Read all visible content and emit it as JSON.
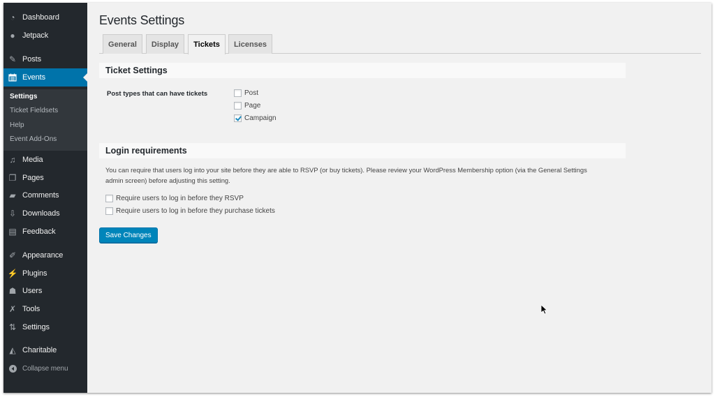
{
  "sidebar": {
    "items": [
      {
        "label": "Dashboard",
        "icon": "dashboard-icon"
      },
      {
        "label": "Jetpack",
        "icon": "jetpack-icon"
      },
      {
        "label": "Posts",
        "icon": "pin-icon"
      },
      {
        "label": "Events",
        "icon": "calendar-icon",
        "active": true
      },
      {
        "label": "Media",
        "icon": "media-icon"
      },
      {
        "label": "Pages",
        "icon": "pages-icon"
      },
      {
        "label": "Comments",
        "icon": "comment-icon"
      },
      {
        "label": "Downloads",
        "icon": "download-icon"
      },
      {
        "label": "Feedback",
        "icon": "feedback-icon"
      },
      {
        "label": "Appearance",
        "icon": "paintbrush-icon"
      },
      {
        "label": "Plugins",
        "icon": "plug-icon"
      },
      {
        "label": "Users",
        "icon": "user-icon"
      },
      {
        "label": "Tools",
        "icon": "wrench-icon"
      },
      {
        "label": "Settings",
        "icon": "sliders-icon"
      },
      {
        "label": "Charitable",
        "icon": "megaphone-icon"
      }
    ],
    "submenu": [
      {
        "label": "Settings",
        "current": true
      },
      {
        "label": "Ticket Fieldsets"
      },
      {
        "label": "Help"
      },
      {
        "label": "Event Add-Ons"
      }
    ],
    "collapse_label": "Collapse menu"
  },
  "page": {
    "title": "Events Settings",
    "tabs": [
      {
        "label": "General"
      },
      {
        "label": "Display"
      },
      {
        "label": "Tickets",
        "active": true
      },
      {
        "label": "Licenses"
      }
    ]
  },
  "ticket_settings": {
    "heading": "Ticket Settings",
    "field_label": "Post types that can have tickets",
    "options": [
      {
        "label": "Post",
        "checked": false
      },
      {
        "label": "Page",
        "checked": false
      },
      {
        "label": "Campaign",
        "checked": true
      }
    ]
  },
  "login_requirements": {
    "heading": "Login requirements",
    "description_line1": "You can require that users log into your site before they are able to RSVP (or buy tickets). Please review your WordPress Membership option (via the General Settings",
    "description_line2": "admin screen) before adjusting this setting.",
    "options": [
      {
        "label": "Require users to log in before they RSVP",
        "checked": false
      },
      {
        "label": "Require users to log in before they purchase tickets",
        "checked": false
      }
    ]
  },
  "save_button": "Save Changes",
  "colors": {
    "sidebar_bg": "#23282d",
    "submenu_bg": "#32373c",
    "accent": "#0073aa",
    "button": "#0085ba",
    "page_bg": "#f1f1f1"
  }
}
